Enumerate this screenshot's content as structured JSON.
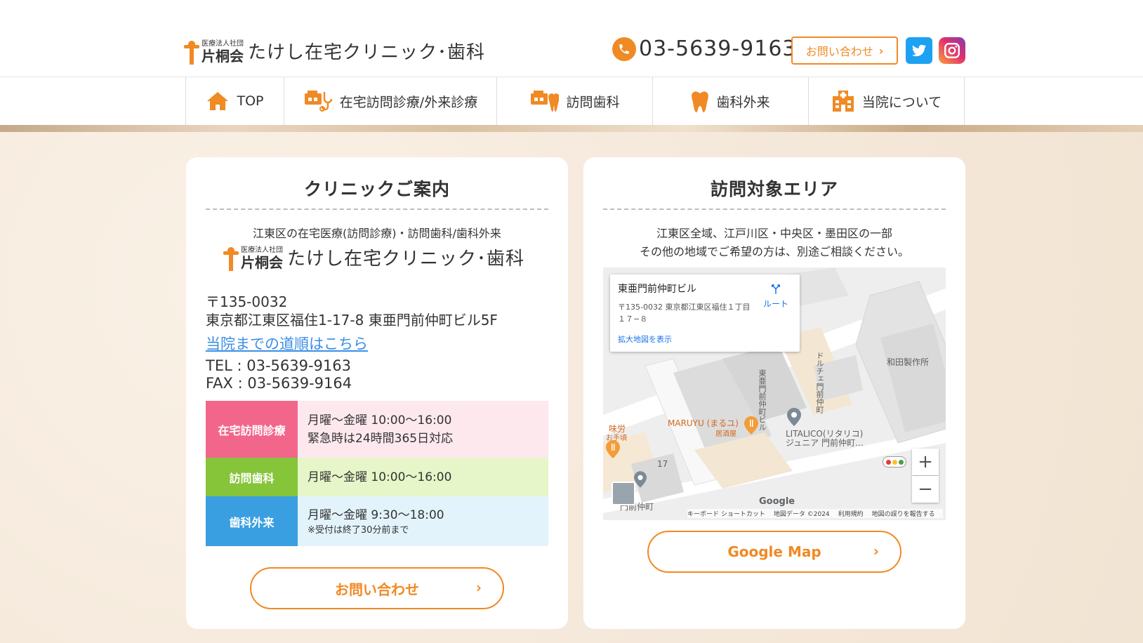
{
  "header": {
    "logo": {
      "corp": "医療法人社団",
      "kata": "片桐会",
      "name": "たけし在宅クリニック･歯科"
    },
    "phone": "03-5639-9163",
    "contact_label": "お問い合わせ",
    "contact_chevron": "›"
  },
  "nav": {
    "items": [
      {
        "label": "TOP",
        "icon": "home-icon"
      },
      {
        "label": "在宅訪問診療/外来診療",
        "icon": "home-visit-icon"
      },
      {
        "label": "訪問歯科",
        "icon": "dental-visit-icon"
      },
      {
        "label": "歯科外来",
        "icon": "tooth-icon"
      },
      {
        "label": "当院について",
        "icon": "hospital-icon"
      }
    ]
  },
  "clinic": {
    "title": "クリニックご案内",
    "subtitle": "江東区の在宅医療(訪問診療)・訪問歯科/歯科外来",
    "logo": {
      "corp": "医療法人社団",
      "kata": "片桐会",
      "name": "たけし在宅クリニック･歯科"
    },
    "postal": "〒135-0032",
    "address": "東京都江東区福住1-17-8 東亜門前仲町ビル5F",
    "route_link": "当院までの道順はこちら",
    "tel": "TEL : 03-5639-9163",
    "fax": "FAX : 03-5639-9164",
    "schedule": [
      {
        "label": "在宅訪問診療",
        "line1": "月曜～金曜 10:00～16:00",
        "line2": "緊急時は24時間365日対応",
        "color": "#f2668b",
        "bg": "#fde8ee"
      },
      {
        "label": "訪問歯科",
        "line1": "月曜～金曜 10:00～16:00",
        "line2": "",
        "color": "#86c43a",
        "bg": "#e6f6c8"
      },
      {
        "label": "歯科外来",
        "line1": "月曜～金曜 9:30～18:00",
        "line2": "※受付は終了30分前まで",
        "color": "#3a9fe0",
        "bg": "#e2f3fb"
      }
    ],
    "contact_button": "お問い合わせ",
    "chevron": "›"
  },
  "area": {
    "title": "訪問対象エリア",
    "line1": "江東区全域、江戸川区・中央区・墨田区の一部",
    "line2": "その他の地域でご希望の方は、別途ご相談ください。",
    "map": {
      "place_title": "東亜門前仲町ビル",
      "place_address": "〒135-0032 東京都江東区福住１丁目１７−８",
      "enlarge_link": "拡大地図を表示",
      "route_label": "ルート",
      "labels": {
        "wada": "和田製作所",
        "maruyu": "MARUYU (まるユ)",
        "izakaya": "居酒屋",
        "litalico": "LITALICO(リタリコ)",
        "litalico2": "ジュニア 門前仲町…",
        "ajiro": "味労",
        "oteate": "お手頃",
        "num17": "17",
        "bldg_vert": "東亜門前仲町ビル",
        "dolce": "ドルチェ門前仲町",
        "monzen": "門前仲町",
        "google": "Google",
        "footer_shortcut": "キーボード ショートカット",
        "footer_data": "地図データ ©2024",
        "footer_terms": "利用規約",
        "footer_report": "地図の誤りを報告する",
        "zoom_in": "+",
        "zoom_out": "−"
      }
    },
    "map_button": "Google Map",
    "chevron": "›"
  },
  "colors": {
    "accent": "#f08a24",
    "link": "#3a8ee6"
  }
}
